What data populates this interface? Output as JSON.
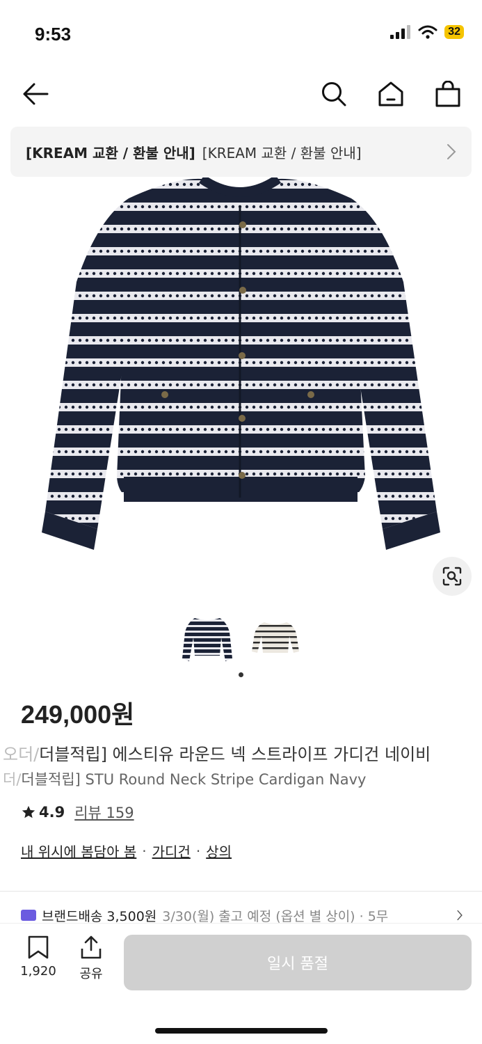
{
  "status": {
    "time": "9:53",
    "battery": "32"
  },
  "nav": {
    "icons": [
      "back-arrow-icon",
      "search-icon",
      "home-icon",
      "shopping-bag-icon"
    ]
  },
  "notice": {
    "bold_text": "[KREAM 교환 / 환불 안내]",
    "text": "[KREAM 교환 / 환불 안내]"
  },
  "product": {
    "price": "249,000원",
    "name_ko_prefix": "오더/",
    "name_ko": "더블적립] 에스티유 라운드 넥 스트라이프 가디건 네이비",
    "name_en_prefix": "더/",
    "name_en": "더블적립] STU Round Neck Stripe Cardigan Navy",
    "rating": "4.9",
    "review_label": "리뷰 159",
    "thumbnails": [
      "navy-cardigan",
      "ivory-cardigan"
    ],
    "active_thumbnail": 0
  },
  "breadcrumb": {
    "item1": "내 위시에 봄담아 봄",
    "sep": "·",
    "item2": "가디건",
    "item3": "상의"
  },
  "delivery": {
    "label": "브랜드배송",
    "price": "3,500원",
    "date": "3/30(월) 출고 예정 (옵션 별 상이) · 5무"
  },
  "bottom": {
    "wish_count": "1,920",
    "share_label": "공유",
    "soldout_label": "일시 품절"
  },
  "colors": {
    "navy": "#1b2236",
    "stripe": "#e9e9ee",
    "soldout": "#d0d0d0",
    "delivery_icon": "#6b5be0"
  }
}
